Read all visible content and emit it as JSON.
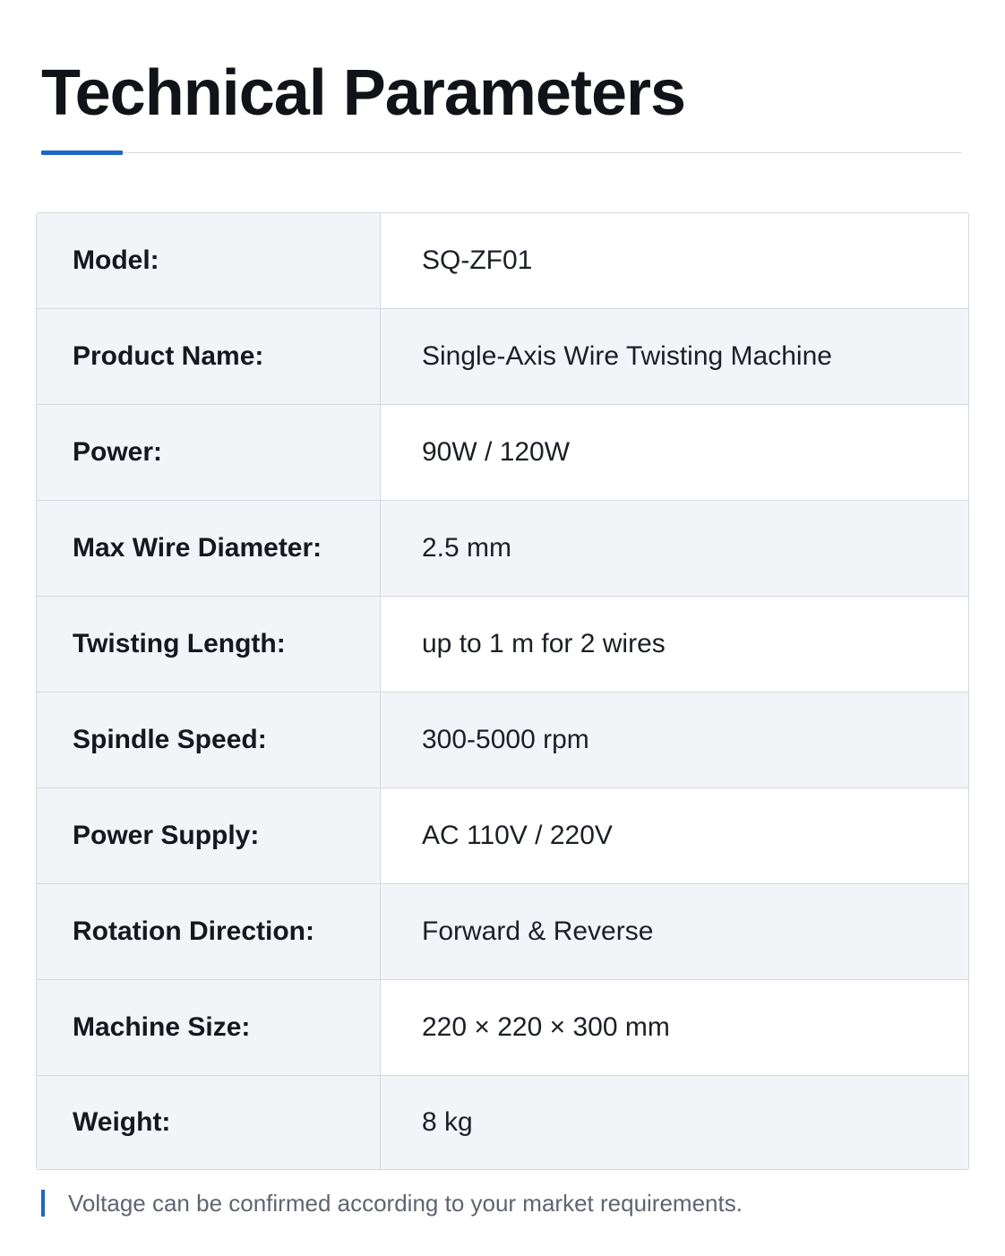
{
  "header": {
    "title": "Technical Parameters"
  },
  "specs": [
    {
      "label": "Model:",
      "value": "SQ-ZF01"
    },
    {
      "label": "Product Name:",
      "value": "Single-Axis Wire Twisting Machine"
    },
    {
      "label": "Power:",
      "value": "90W / 120W"
    },
    {
      "label": "Max Wire Diameter:",
      "value": "2.5 mm"
    },
    {
      "label": "Twisting Length:",
      "value": "up to 1 m for 2 wires"
    },
    {
      "label": "Spindle Speed:",
      "value": "300-5000 rpm"
    },
    {
      "label": "Power Supply:",
      "value": "AC 110V / 220V"
    },
    {
      "label": "Rotation Direction:",
      "value": "Forward & Reverse"
    },
    {
      "label": "Machine Size:",
      "value": "220 × 220 × 300 mm"
    },
    {
      "label": "Weight:",
      "value": "8 kg"
    }
  ],
  "note": {
    "text": "Voltage can be confirmed according to your market requirements."
  },
  "colors": {
    "accent": "#1f66c4",
    "label_background": "#f2f4f7",
    "border": "#d4d8de"
  }
}
